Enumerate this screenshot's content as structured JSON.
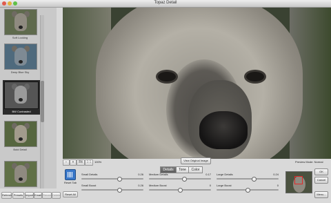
{
  "window": {
    "title": "Topaz Detail"
  },
  "presets": [
    {
      "label": "Soft Looking"
    },
    {
      "label": "Deep Blue Sky"
    },
    {
      "label": "BW Contrasted",
      "selected": true
    },
    {
      "label": "Bold Detail"
    },
    {
      "label": ""
    }
  ],
  "left_buttons": {
    "refresh": "Refresh",
    "presets": "Presets",
    "import": "Import",
    "email": "Email",
    "rename": "Rename",
    "delete": "Delete"
  },
  "reset": {
    "tab_label": "Reset Tab",
    "all_label": "Reset All"
  },
  "zoom": {
    "minus": "−",
    "plus": "+",
    "fit": "Fit",
    "one_to_one": "1:1",
    "value": "100%"
  },
  "view_original": "View Original Image",
  "preview_mode": {
    "label": "Preview Mode:",
    "value": "Normal"
  },
  "tabs": [
    {
      "label": "Details",
      "active": true
    },
    {
      "label": "Tone"
    },
    {
      "label": "Color"
    }
  ],
  "sliders": [
    {
      "label": "Small Details",
      "value": "0.26",
      "fraction": 0.63
    },
    {
      "label": "Medium Details",
      "value": "0.17",
      "fraction": 0.58
    },
    {
      "label": "Large Details",
      "value": "0.24",
      "fraction": 0.62
    },
    {
      "label": "Small Boost",
      "value": "0.26",
      "fraction": 0.63
    },
    {
      "label": "Medium Boost",
      "value": "0",
      "fraction": 0.5
    },
    {
      "label": "Large Boost",
      "value": "0",
      "fraction": 0.5
    }
  ],
  "right_buttons": {
    "ok": "OK",
    "cancel": "Cancel",
    "menu": "Menu..."
  },
  "colors": {
    "active_tab": "#6a6a6a",
    "reset_icon": "#3a78c9",
    "mini_preview_box": "#e02828"
  },
  "icons": {
    "reset_tab": "reset-tab-icon"
  }
}
